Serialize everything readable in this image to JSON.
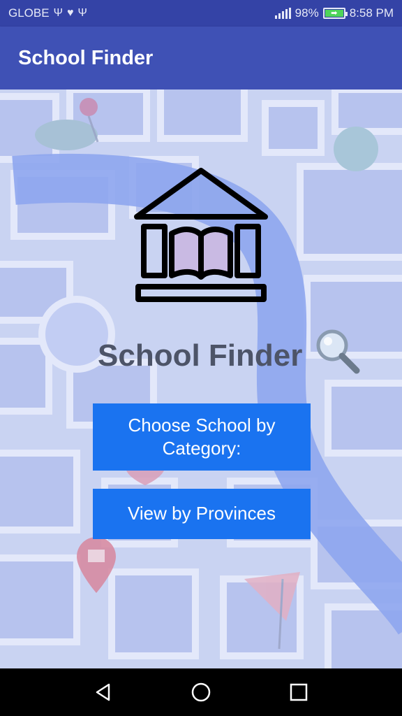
{
  "status_bar": {
    "carrier": "GLOBE",
    "battery_percent": "98%",
    "time": "8:58 PM",
    "left_icons": [
      "usb-icon",
      "heart-rate-icon",
      "usb-icon"
    ],
    "right_icons": [
      "signal-icon",
      "battery-charging-icon"
    ]
  },
  "app_bar": {
    "title": "School Finder"
  },
  "main": {
    "headline": "School Finder",
    "buttons": {
      "category": "Choose School by Category:",
      "provinces": "View by Provinces"
    }
  },
  "nav_bar": {
    "icons": [
      "back-icon",
      "home-icon",
      "recents-icon"
    ]
  },
  "colors": {
    "status_bar": "#3443a6",
    "app_bar": "#3f51b5",
    "button": "#1a73f0",
    "headline": "#4d5468",
    "map_bg": "#c9d3f2"
  }
}
